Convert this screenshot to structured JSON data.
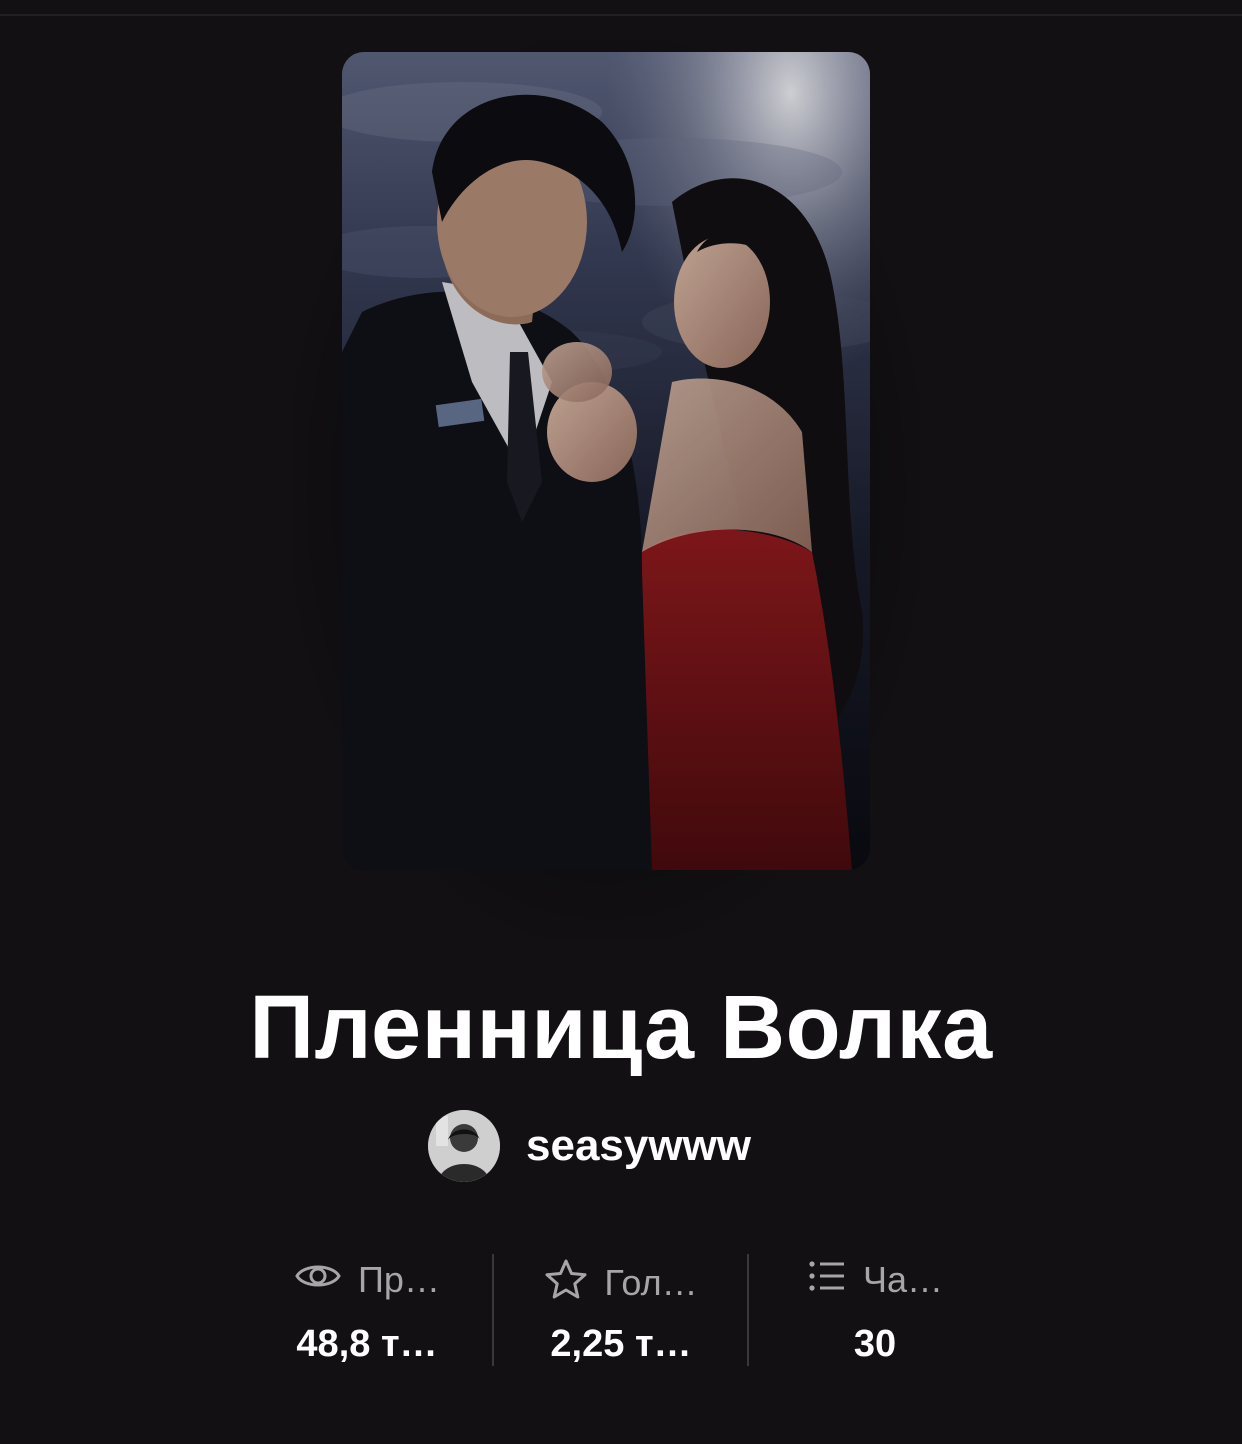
{
  "story": {
    "title": "Пленница Волка",
    "author": "seasywww"
  },
  "stats": [
    {
      "icon": "eye-icon",
      "label": "Пр…",
      "value": "48,8 т…"
    },
    {
      "icon": "star-icon",
      "label": "Гол…",
      "value": "2,25 т…"
    },
    {
      "icon": "list-icon",
      "label": "Ча…",
      "value": "30"
    }
  ],
  "colors": {
    "background": "#121013",
    "text_primary": "#ffffff",
    "text_secondary": "#a7a5aa",
    "divider": "#3a383d"
  }
}
